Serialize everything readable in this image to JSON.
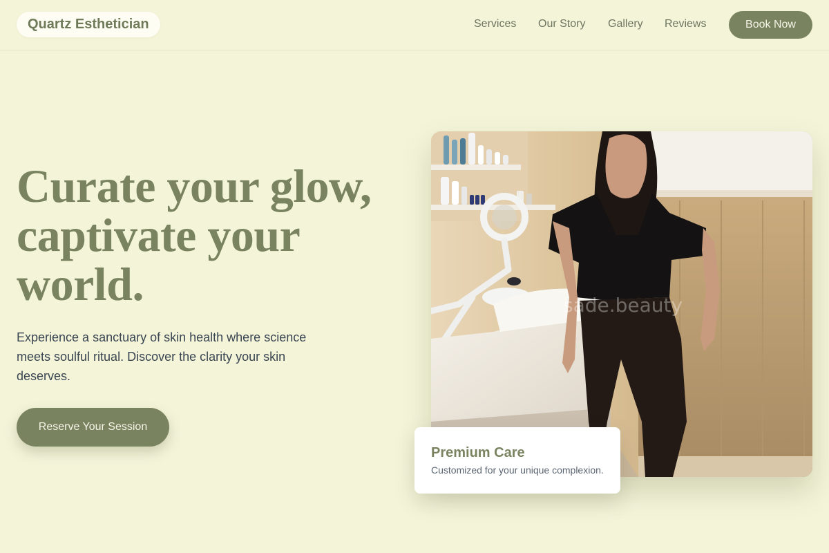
{
  "header": {
    "logo": "Quartz Esthetician",
    "nav": [
      {
        "label": "Services"
      },
      {
        "label": "Our Story"
      },
      {
        "label": "Gallery"
      },
      {
        "label": "Reviews"
      }
    ],
    "book_label": "Book Now"
  },
  "hero": {
    "title_line1": "Curate your glow,",
    "title_line2": "captivate your",
    "title_line3": "world.",
    "subtitle": "Experience a sanctuary of skin health where science meets soulful ritual. Discover the clarity your skin deserves.",
    "cta_label": "Reserve Your Session"
  },
  "image": {
    "watermark": "sade.beauty"
  },
  "card": {
    "title": "Premium Care",
    "text": "Customized for your unique complexion."
  },
  "colors": {
    "background": "#f4f4d9",
    "accent": "#7a8360",
    "card": "#ffffff"
  }
}
